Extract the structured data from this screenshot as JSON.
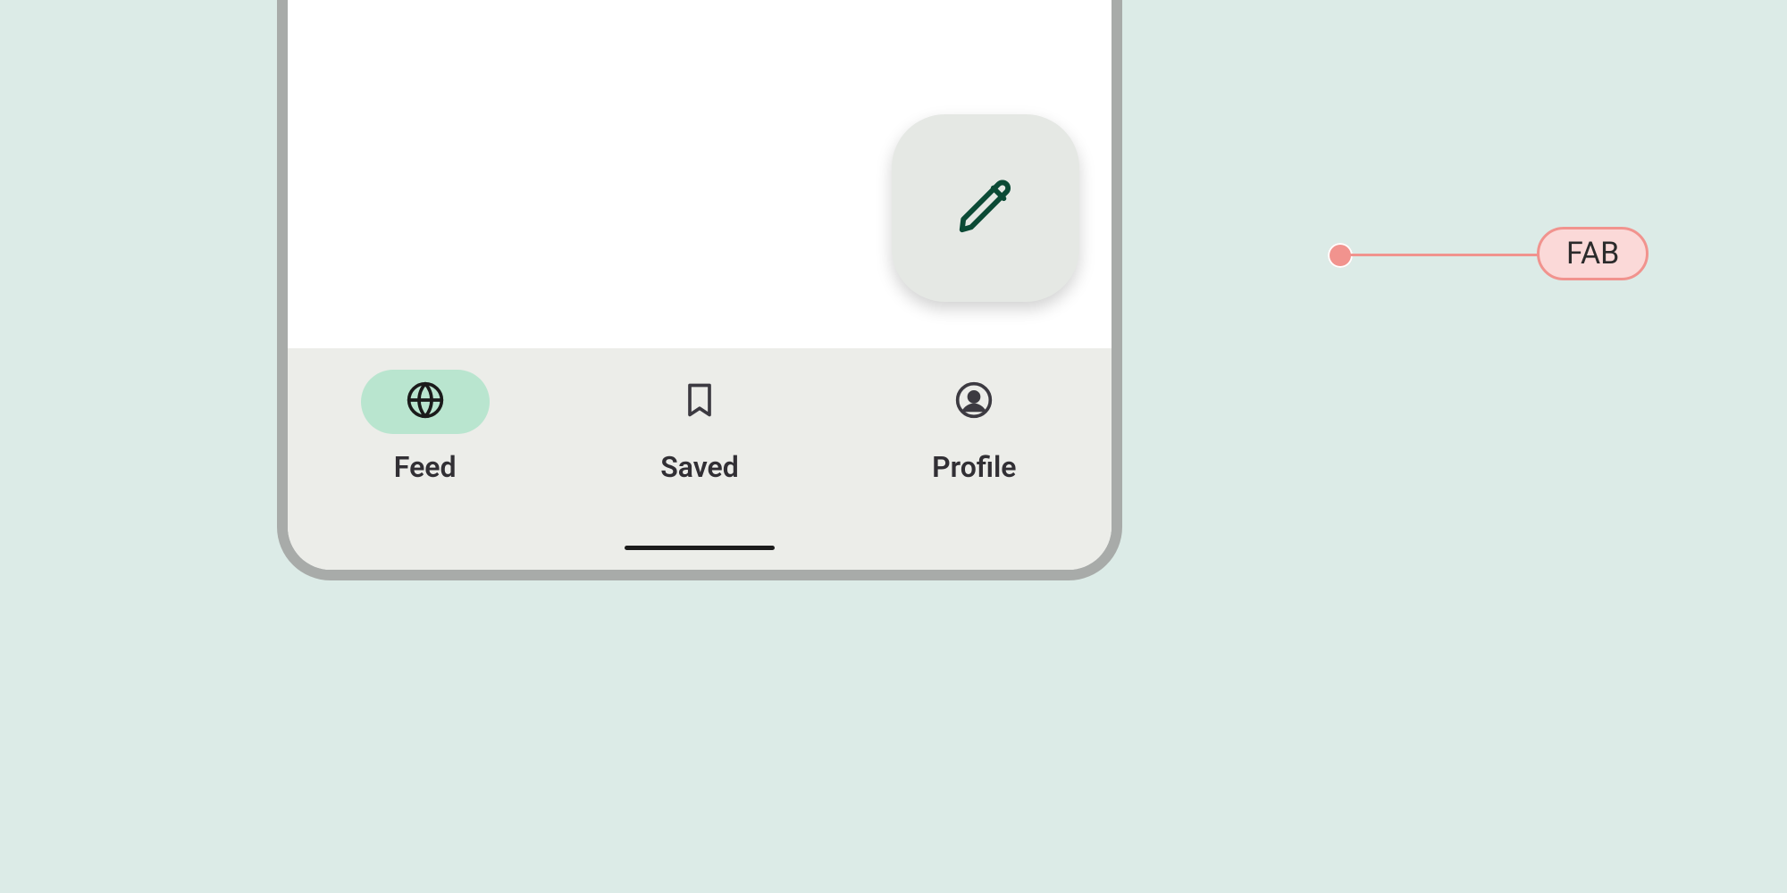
{
  "nav": {
    "items": [
      {
        "label": "Feed",
        "active": true
      },
      {
        "label": "Saved",
        "active": false
      },
      {
        "label": "Profile",
        "active": false
      }
    ]
  },
  "annotation": {
    "fab_label": "FAB"
  },
  "colors": {
    "background": "#dcebe7",
    "frame": "#a8aba9",
    "navbar": "#ecede9",
    "active_pill": "#b9e5cf",
    "fab_bg": "#e5e8e4",
    "fab_icon": "#0b4a35",
    "annotation": "#f1938e",
    "annotation_fill": "#fbd9d8",
    "text": "#312f34"
  }
}
